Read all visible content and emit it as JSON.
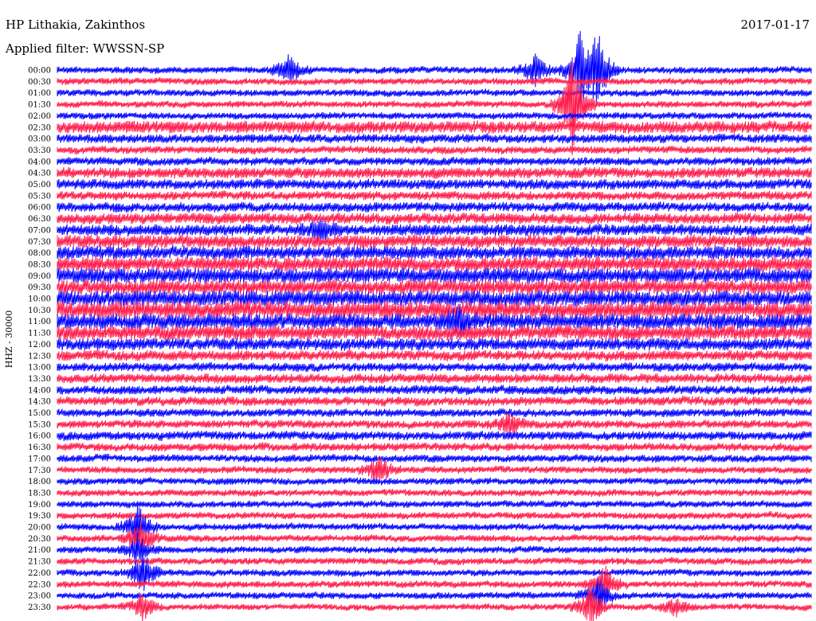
{
  "header": {
    "station": "HP Lithakia, Zakinthos",
    "filter": "Applied filter: WWSSN-SP",
    "date": "2017-01-17"
  },
  "colors": {
    "trace_a": "#0000ff",
    "trace_b": "#ff1a4a",
    "background": "#ffffff"
  },
  "chart_data": {
    "type": "line",
    "title": "HP Lithakia, Zakinthos",
    "subtitle": "Applied filter: WWSSN-SP",
    "date": "2017-01-17",
    "ylabel": "HHZ - 30000",
    "y_tick_labels": [
      "00:00",
      "00:30",
      "01:00",
      "01:30",
      "02:00",
      "02:30",
      "03:00",
      "03:30",
      "04:00",
      "04:30",
      "05:00",
      "05:30",
      "06:00",
      "06:30",
      "07:00",
      "07:30",
      "08:00",
      "08:30",
      "09:00",
      "09:30",
      "10:00",
      "10:30",
      "11:00",
      "11:30",
      "12:00",
      "12:30",
      "13:00",
      "13:30",
      "14:00",
      "14:30",
      "15:00",
      "15:30",
      "16:00",
      "16:30",
      "17:00",
      "17:30",
      "18:00",
      "18:30",
      "19:00",
      "19:30",
      "20:00",
      "20:30",
      "21:00",
      "21:30",
      "22:00",
      "22:30",
      "23:00",
      "23:30"
    ],
    "row_duration_minutes": 30,
    "trace_colors_alternate": [
      "blue",
      "red"
    ],
    "noise_level": [
      1.0,
      1.0,
      1.0,
      1.0,
      1.0,
      1.8,
      1.3,
      1.1,
      1.2,
      1.6,
      1.5,
      1.3,
      1.4,
      1.6,
      1.7,
      1.9,
      2.0,
      2.2,
      2.3,
      2.2,
      2.4,
      2.6,
      2.4,
      2.2,
      1.8,
      1.5,
      1.3,
      1.4,
      1.3,
      1.3,
      1.2,
      1.2,
      1.3,
      1.2,
      1.1,
      1.0,
      1.0,
      1.0,
      1.0,
      1.0,
      1.0,
      1.0,
      1.0,
      1.0,
      1.0,
      1.0,
      1.0,
      0.9
    ],
    "events": [
      {
        "row": 0,
        "minute": 9.2,
        "amplitude": 5.0
      },
      {
        "row": 0,
        "minute": 19.0,
        "amplitude": 4.5
      },
      {
        "row": 0,
        "minute": 20.8,
        "amplitude": 10.0
      },
      {
        "row": 0,
        "minute": 21.5,
        "amplitude": 12.0
      },
      {
        "row": 3,
        "minute": 20.5,
        "amplitude": 14.0
      },
      {
        "row": 14,
        "minute": 10.5,
        "amplitude": 3.0
      },
      {
        "row": 22,
        "minute": 16.0,
        "amplitude": 3.5
      },
      {
        "row": 31,
        "minute": 18.0,
        "amplitude": 3.0
      },
      {
        "row": 35,
        "minute": 12.8,
        "amplitude": 4.0
      },
      {
        "row": 40,
        "minute": 3.2,
        "amplitude": 6.0
      },
      {
        "row": 41,
        "minute": 3.3,
        "amplitude": 5.5
      },
      {
        "row": 42,
        "minute": 3.2,
        "amplitude": 4.0
      },
      {
        "row": 44,
        "minute": 3.4,
        "amplitude": 6.0
      },
      {
        "row": 45,
        "minute": 21.8,
        "amplitude": 5.0
      },
      {
        "row": 46,
        "minute": 21.5,
        "amplitude": 5.0
      },
      {
        "row": 47,
        "minute": 3.4,
        "amplitude": 4.0
      },
      {
        "row": 47,
        "minute": 21.2,
        "amplitude": 6.0
      },
      {
        "row": 47,
        "minute": 24.6,
        "amplitude": 2.5
      }
    ]
  }
}
